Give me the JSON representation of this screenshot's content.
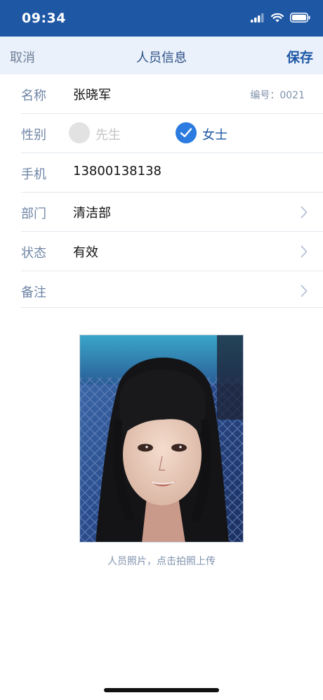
{
  "status_bar": {
    "time": "09:34"
  },
  "nav": {
    "cancel": "取消",
    "title": "人员信息",
    "save": "保存"
  },
  "form": {
    "name": {
      "label": "名称",
      "value": "张晓军",
      "id_text": "编号：0021"
    },
    "gender": {
      "label": "性别",
      "options": [
        "先生",
        "女士"
      ],
      "selected": "女士"
    },
    "phone": {
      "label": "手机",
      "value": "13800138138"
    },
    "department": {
      "label": "部门",
      "value": "清洁部"
    },
    "status": {
      "label": "状态",
      "value": "有效"
    },
    "note": {
      "label": "备注",
      "value": ""
    }
  },
  "photo": {
    "caption": "人员照片，点击拍照上传"
  },
  "colors": {
    "primary": "#1e57a4",
    "nav_bg": "#eaf1fb",
    "check": "#2b7be0",
    "label": "#6f86a6"
  }
}
